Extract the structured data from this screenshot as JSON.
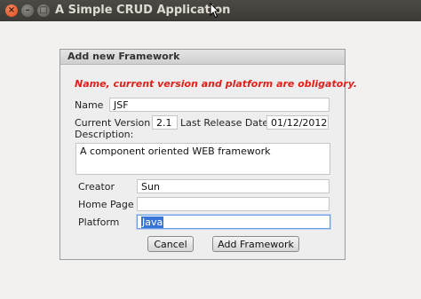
{
  "window": {
    "title": "A Simple CRUD Application",
    "buttons": {
      "close": "×",
      "minimize": "–",
      "maximize": "□"
    }
  },
  "dialog": {
    "title": "Add new Framework",
    "warning": "Name, current version and platform are obligatory.",
    "labels": {
      "name": "Name",
      "current_version": "Current Version",
      "last_release_date": "Last Release Date",
      "description": "Description:",
      "creator": "Creator",
      "home_page": "Home Page",
      "platform": "Platform"
    },
    "values": {
      "name": "JSF",
      "current_version": "2.1",
      "last_release_date": "01/12/2012",
      "description": "A component oriented WEB framework",
      "creator": "Sun",
      "home_page": "",
      "platform": "Java"
    },
    "buttons": {
      "cancel": "Cancel",
      "add": "Add Framework"
    }
  }
}
